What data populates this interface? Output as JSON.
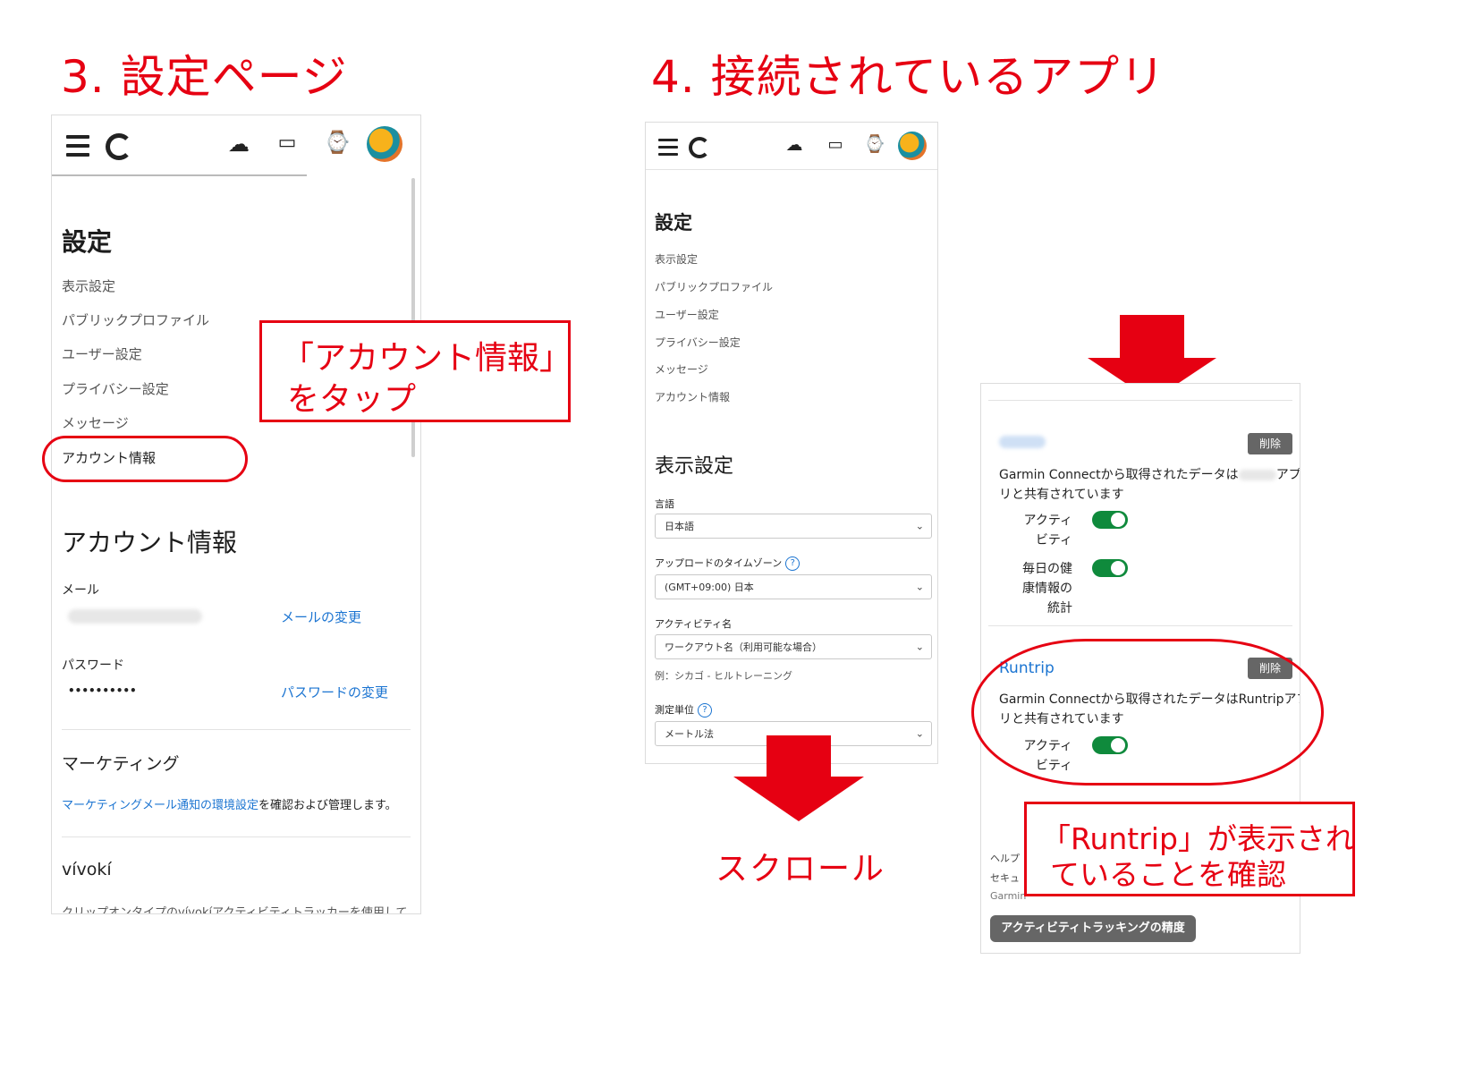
{
  "step3": {
    "title": "3. 設定ページ"
  },
  "step4": {
    "title": "4. 接続されているアプリ"
  },
  "panel1": {
    "icons": [
      "menu-icon",
      "garmin-logo-icon",
      "upload-icon",
      "inbox-icon",
      "watch-icon",
      "avatar"
    ],
    "settings_heading": "設定",
    "menu": [
      "表示設定",
      "パブリックプロファイル",
      "ユーザー設定",
      "プライバシー設定",
      "メッセージ",
      "アカウント情報"
    ],
    "account_heading": "アカウント情報",
    "email_label": "メール",
    "email_change": "メールの変更",
    "password_label": "パスワード",
    "password_value": "••••••••••",
    "password_change": "パスワードの変更",
    "marketing_heading": "マーケティング",
    "marketing_link": "マーケティングメール通知の環境設定",
    "marketing_text": "を確認および管理します。",
    "vivoki_heading": "vívokí",
    "cut_text": "クリップオンタイプのvívokíアクティビティトラッカーを使用して"
  },
  "panel2": {
    "settings_heading": "設定",
    "menu": [
      "表示設定",
      "パブリックプロファイル",
      "ユーザー設定",
      "プライバシー設定",
      "メッセージ",
      "アカウント情報"
    ],
    "display_heading": "表示設定",
    "language_label": "言語",
    "language_value": "日本語",
    "timezone_label": "アップロードのタイムゾーン",
    "timezone_value": "(GMT+09:00) 日本",
    "activity_name_label": "アクティビティ名",
    "activity_name_value": "ワークアウト名（利用可能な場合）",
    "activity_name_example": "例：シカゴ - ヒルトレーニング",
    "units_label": "測定単位",
    "units_value": "メートル法"
  },
  "panel3": {
    "delete_label": "削除",
    "app1_text_a": "Garmin Connectから取得されたデータは",
    "app1_text_b": "アプ",
    "app1_text_c": "リと共有されています",
    "toggle_activity": "アクティビティ",
    "toggle_activity_l1": "アクティ",
    "toggle_activity_l2": "ビティ",
    "toggle_health_l1": "毎日の健",
    "toggle_health_l2": "康情報の",
    "toggle_health_l3": "統計",
    "app2_name": "Runtrip",
    "app2_text_a": "Garmin Connectから取得されたデータはRuntripアプ",
    "app2_text_b": "リと共有されています",
    "footer_help": "ヘルプ",
    "footer_security": "セキュ",
    "footer_copyright": "Garmin",
    "accuracy_button": "アクティビティトラッキングの精度"
  },
  "annotations": {
    "callout1_line1": "「アカウント情報」",
    "callout1_line2": "をタップ",
    "scroll_label": "スクロール",
    "callout2_line1": "「Runtrip」が表示され",
    "callout2_line2": "ていることを確認"
  },
  "colors": {
    "accent_red": "#e60012",
    "link_blue": "#1b74d1",
    "toggle_green": "#0f8a3c"
  }
}
